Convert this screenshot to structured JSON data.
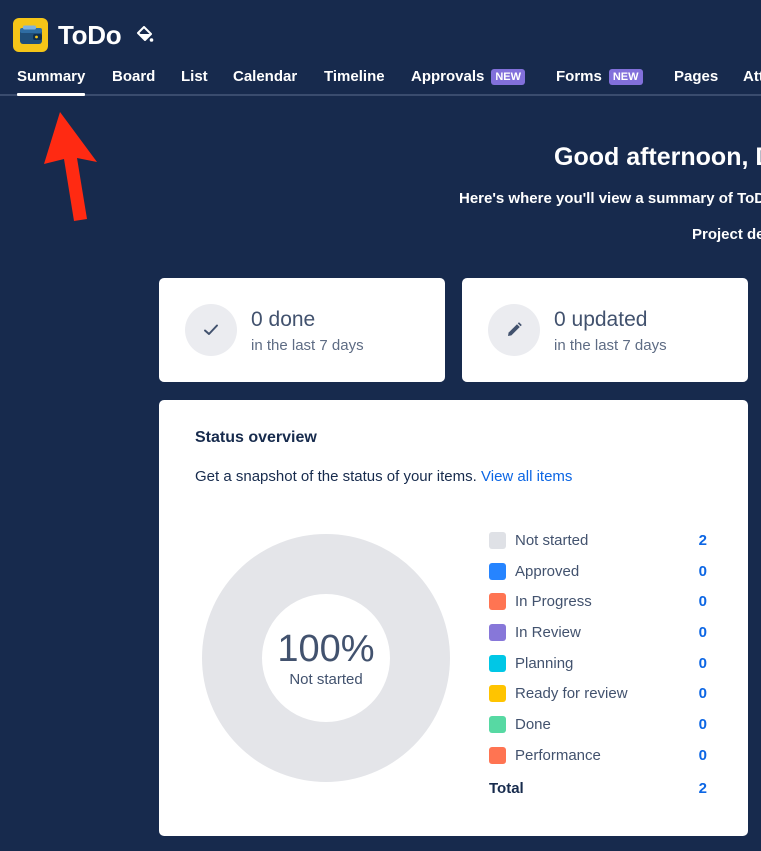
{
  "app": {
    "title": "ToDo"
  },
  "tabs": [
    {
      "label": "Summary",
      "active": true
    },
    {
      "label": "Board"
    },
    {
      "label": "List"
    },
    {
      "label": "Calendar"
    },
    {
      "label": "Timeline"
    },
    {
      "label": "Approvals",
      "badge": "NEW"
    },
    {
      "label": "Forms",
      "badge": "NEW"
    },
    {
      "label": "Pages"
    },
    {
      "label": "Att"
    }
  ],
  "greeting": "Good afternoon, D",
  "subtitle": "Here's where you'll view a summary of ToD",
  "project_link": "Project de",
  "stats": [
    {
      "value": "0 done",
      "sub": "in the last 7 days",
      "icon": "check-icon"
    },
    {
      "value": "0 updated",
      "sub": "in the last 7 days",
      "icon": "pencil-icon"
    }
  ],
  "status_overview": {
    "title": "Status overview",
    "description": "Get a snapshot of the status of your items.",
    "link": "View all items",
    "donut_percent": "100%",
    "donut_label": "Not started",
    "items": [
      {
        "label": "Not started",
        "count": "2",
        "color": "#dfe1e6"
      },
      {
        "label": "Approved",
        "count": "0",
        "color": "#2684ff"
      },
      {
        "label": "In Progress",
        "count": "0",
        "color": "#ff7452"
      },
      {
        "label": "In Review",
        "count": "0",
        "color": "#8777d9"
      },
      {
        "label": "Planning",
        "count": "0",
        "color": "#00c7e6"
      },
      {
        "label": "Ready for review",
        "count": "0",
        "color": "#ffc400"
      },
      {
        "label": "Done",
        "count": "0",
        "color": "#57d9a3"
      },
      {
        "label": "Performance",
        "count": "0",
        "color": "#ff7452"
      }
    ],
    "total_label": "Total",
    "total_count": "2"
  },
  "colors": {
    "background": "#172a4d",
    "accent": "#0c66e4",
    "arrow": "#ff2a12",
    "donut": "#e4e5e9"
  }
}
